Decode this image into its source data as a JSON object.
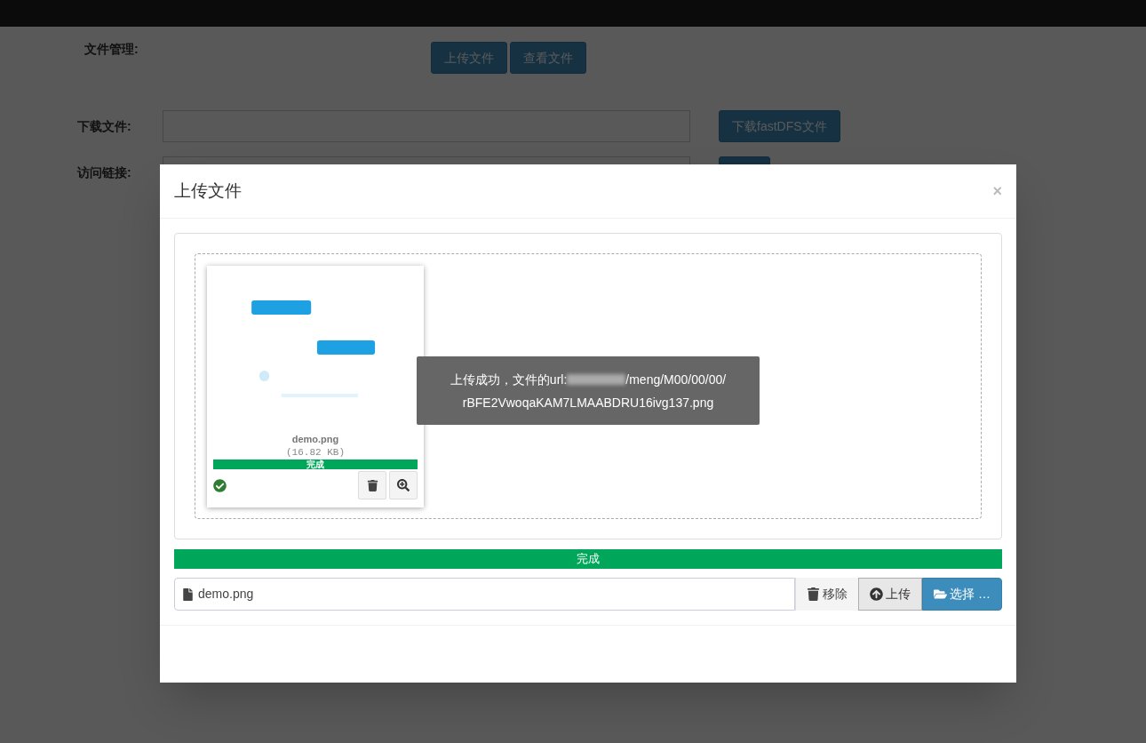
{
  "page": {
    "title": "文件管理:",
    "buttons": [
      "上传文件",
      "查看文件"
    ],
    "rows": [
      {
        "label": "下载文件:",
        "button": "下载fastDFS文件"
      },
      {
        "label": "访问链接:"
      }
    ]
  },
  "modal": {
    "title": "上传文件",
    "close": "×",
    "preview": {
      "kind": "picture",
      "filename": "demo.png",
      "size": "(16.82 KB)",
      "progress": {
        "level": 1,
        "label": "完成"
      },
      "success": true
    },
    "toast": {
      "text": "上传成功，文件的url:",
      "redacted": true,
      "path": "/meng/M00/00/00/",
      "file": "rBFE2VwoqaKAM7LMAABDRU16ivg137.png"
    },
    "progress": {
      "level": 1,
      "label": "完成"
    },
    "file_field": {
      "value": "demo.png"
    },
    "buttons": [
      {
        "kind": "remove",
        "label": "移除"
      },
      {
        "kind": "upload",
        "label": "上传"
      },
      {
        "kind": "browse",
        "label": "选择 …"
      }
    ]
  }
}
